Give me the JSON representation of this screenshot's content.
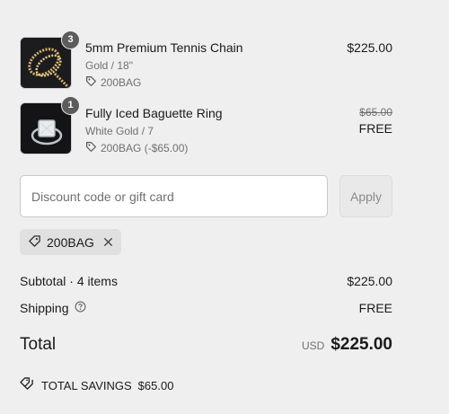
{
  "line_items": [
    {
      "title": "5mm Premium Tennis Chain",
      "variant": "Gold / 18\"",
      "quantity": "3",
      "discount_code": "200BAG",
      "price": "$225.00",
      "image_icon": "tennis-chain-thumbnail"
    },
    {
      "title": "Fully Iced Baguette Ring",
      "variant": "White Gold / 7",
      "quantity": "1",
      "discount_code": "200BAG (-$65.00)",
      "original_price": "$65.00",
      "price": "FREE",
      "image_icon": "baguette-ring-thumbnail"
    }
  ],
  "discount": {
    "placeholder": "Discount code or gift card",
    "apply_label": "Apply",
    "applied_code": "200BAG"
  },
  "summary": {
    "subtotal_label": "Subtotal · 4 items",
    "subtotal_value": "$225.00",
    "shipping_label": "Shipping",
    "shipping_value": "FREE",
    "total_label": "Total",
    "currency": "USD",
    "total_value": "$225.00",
    "savings_label": "TOTAL SAVINGS",
    "savings_value": "$65.00"
  },
  "colors": {
    "background": "#efefef",
    "muted_text": "#707070",
    "tag_bg": "#e0e0e0"
  }
}
